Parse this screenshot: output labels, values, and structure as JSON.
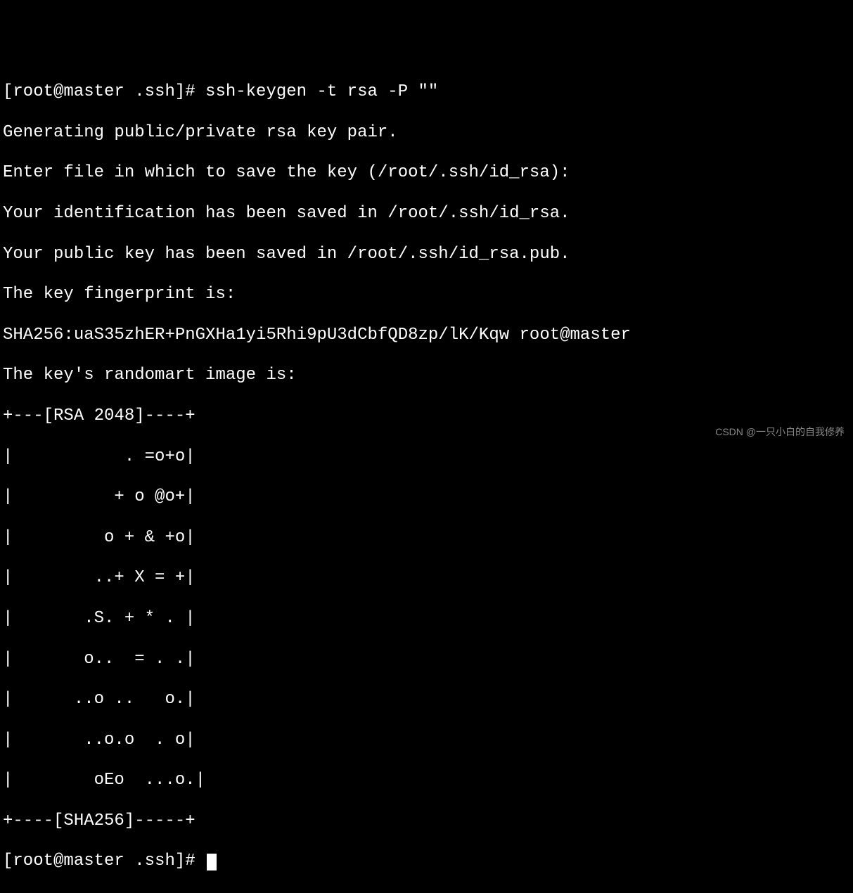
{
  "terminal": {
    "line1": "[root@master .ssh]# ssh-keygen -t rsa -P \"\"",
    "line2": "Generating public/private rsa key pair.",
    "line3": "Enter file in which to save the key (/root/.ssh/id_rsa):",
    "line4": "Your identification has been saved in /root/.ssh/id_rsa.",
    "line5": "Your public key has been saved in /root/.ssh/id_rsa.pub.",
    "line6": "The key fingerprint is:",
    "line7": "SHA256:uaS35zhER+PnGXHa1yi5Rhi9pU3dCbfQD8zp/lK/Kqw root@master",
    "line8": "The key's randomart image is:",
    "art1": "+---[RSA 2048]----+",
    "art2": "|           . =o+o|",
    "art3": "|          + o @o+|",
    "art4": "|         o + & +o|",
    "art5": "|        ..+ X = +|",
    "art6": "|       .S. + * . |",
    "art7": "|       o..  = . .|",
    "art8": "|      ..o ..   o.|",
    "art9": "|       ..o.o  . o|",
    "art10": "|        oEo  ...o.|",
    "art11": "+----[SHA256]-----+",
    "prompt": "[root@master .ssh]# "
  },
  "watermark": "CSDN @一只小白的自我修养"
}
